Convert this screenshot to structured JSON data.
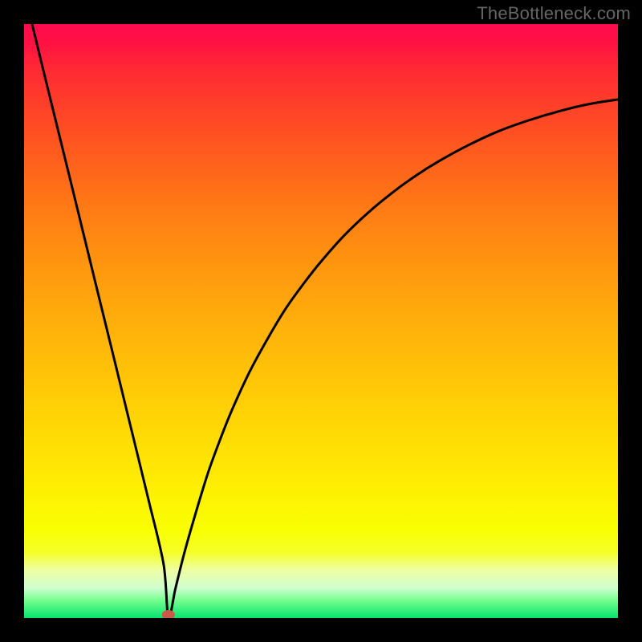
{
  "watermark": "TheBottleneck.com",
  "chart_data": {
    "type": "line",
    "title": "",
    "xlabel": "",
    "ylabel": "",
    "xlim": [
      0,
      100
    ],
    "ylim": [
      0,
      100
    ],
    "grid": false,
    "legend": false,
    "annotations": [
      {
        "kind": "minimum-marker",
        "x": 24.3,
        "y": 0
      }
    ],
    "series": [
      {
        "name": "curve",
        "x": [
          1.35,
          3,
          6,
          9,
          12,
          15,
          18,
          21,
          23.5,
          24.3,
          25.5,
          27,
          29,
          31,
          33,
          35,
          38,
          41,
          44,
          47,
          50,
          54,
          58,
          62,
          66,
          70,
          75,
          80,
          85,
          90,
          95,
          100
        ],
        "y": [
          100,
          93.2,
          81,
          68.8,
          56.5,
          44.3,
          32,
          19.7,
          9,
          0,
          5,
          11,
          18,
          24.5,
          30,
          35,
          41.5,
          47,
          52,
          56.2,
          60,
          64.5,
          68.3,
          71.6,
          74.5,
          77,
          79.7,
          82,
          83.8,
          85.3,
          86.5,
          87.3
        ]
      }
    ],
    "colors": {
      "top": "#ff0b4f",
      "mid": "#ffd100",
      "bottom": "#05e46e",
      "curve": "#000000",
      "dot": "#c85a4a"
    }
  }
}
